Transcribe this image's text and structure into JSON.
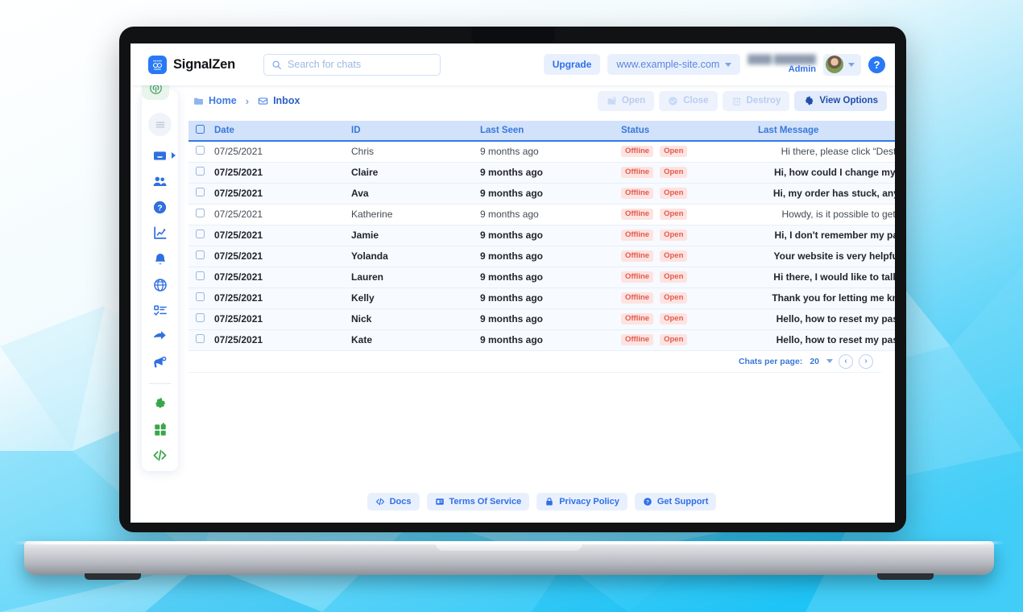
{
  "app": {
    "brand_name": "SignalZen",
    "brand_icon": "signalzen-logo-icon"
  },
  "header": {
    "search": {
      "placeholder": "Search for chats",
      "value": "",
      "icon": "search-icon"
    },
    "upgrade_label": "Upgrade",
    "site_selector": {
      "label": "www.example-site.com",
      "icon": "chevron-down-icon"
    },
    "user": {
      "name": "████ ███████",
      "role": "Admin",
      "avatar": "user-avatar"
    },
    "help_label": "?"
  },
  "breadcrumb": {
    "items": [
      {
        "label": "Home",
        "icon": "folder-icon"
      },
      {
        "label": "Inbox",
        "icon": "inbox-icon"
      }
    ],
    "separator": "›"
  },
  "toolbar": {
    "actions": [
      {
        "label": "Open",
        "icon": "open-external-icon",
        "enabled": false
      },
      {
        "label": "Close",
        "icon": "check-circle-icon",
        "enabled": false
      },
      {
        "label": "Destroy",
        "icon": "trash-icon",
        "enabled": false
      },
      {
        "label": "View Options",
        "icon": "gear-icon",
        "enabled": true
      }
    ]
  },
  "sidebar": {
    "logo_icon": "signal-broadcast-icon",
    "toggle_icon": "hamburger-menu-icon",
    "items": [
      {
        "name": "inbox",
        "icon": "inbox-icon",
        "color": "#2f6fe0",
        "has_submenu": true
      },
      {
        "name": "contacts",
        "icon": "users-icon",
        "color": "#2f6fe0",
        "has_submenu": false
      },
      {
        "name": "help",
        "icon": "question-circle-icon",
        "color": "#2f6fe0",
        "has_submenu": false
      },
      {
        "name": "analytics",
        "icon": "chart-icon",
        "color": "#2f6fe0",
        "has_submenu": false
      },
      {
        "name": "notifications",
        "icon": "bell-icon",
        "color": "#2f6fe0",
        "has_submenu": false
      },
      {
        "name": "web",
        "icon": "globe-icon",
        "color": "#2f6fe0",
        "has_submenu": false
      },
      {
        "name": "tasks",
        "icon": "checklist-icon",
        "color": "#2f6fe0",
        "has_submenu": false
      },
      {
        "name": "broadcast",
        "icon": "send-arrow-icon",
        "color": "#2f6fe0",
        "has_submenu": false
      },
      {
        "name": "campaigns",
        "icon": "megaphone-icon",
        "color": "#2f6fe0",
        "has_submenu": false
      }
    ],
    "bottom_items": [
      {
        "name": "settings",
        "icon": "gear-icon",
        "color": "#3aa64a"
      },
      {
        "name": "apps",
        "icon": "grid-apps-icon",
        "color": "#3aa64a"
      },
      {
        "name": "developers",
        "icon": "code-icon",
        "color": "#3aa64a"
      }
    ]
  },
  "table": {
    "columns": [
      "Date",
      "ID",
      "Last Seen",
      "Status",
      "Last Message"
    ],
    "rows": [
      {
        "read": true,
        "date": "07/25/2021",
        "id": "Chris",
        "last_seen": "9 months ago",
        "status": [
          "Offline",
          "Open"
        ],
        "message": "Hi there, please click “Desti..."
      },
      {
        "read": false,
        "date": "07/25/2021",
        "id": "Claire",
        "last_seen": "9 months ago",
        "status": [
          "Offline",
          "Open"
        ],
        "message": "Hi, how could I change my ..."
      },
      {
        "read": false,
        "date": "07/25/2021",
        "id": "Ava",
        "last_seen": "9 months ago",
        "status": [
          "Offline",
          "Open"
        ],
        "message": "Hi, my order has stuck, any..."
      },
      {
        "read": true,
        "date": "07/25/2021",
        "id": "Katherine",
        "last_seen": "9 months ago",
        "status": [
          "Offline",
          "Open"
        ],
        "message": "Howdy, is it possible to get ..."
      },
      {
        "read": false,
        "date": "07/25/2021",
        "id": "Jamie",
        "last_seen": "9 months ago",
        "status": [
          "Offline",
          "Open"
        ],
        "message": "Hi, I don't remember my pa..."
      },
      {
        "read": false,
        "date": "07/25/2021",
        "id": "Yolanda",
        "last_seen": "9 months ago",
        "status": [
          "Offline",
          "Open"
        ],
        "message": "Your website is very helpfu..."
      },
      {
        "read": false,
        "date": "07/25/2021",
        "id": "Lauren",
        "last_seen": "9 months ago",
        "status": [
          "Offline",
          "Open"
        ],
        "message": "Hi there, I would like to talk..."
      },
      {
        "read": false,
        "date": "07/25/2021",
        "id": "Kelly",
        "last_seen": "9 months ago",
        "status": [
          "Offline",
          "Open"
        ],
        "message": "Thank you for letting me kn..."
      },
      {
        "read": false,
        "date": "07/25/2021",
        "id": "Nick",
        "last_seen": "9 months ago",
        "status": [
          "Offline",
          "Open"
        ],
        "message": "Hello, how to reset my pas..."
      },
      {
        "read": false,
        "date": "07/25/2021",
        "id": "Kate",
        "last_seen": "9 months ago",
        "status": [
          "Offline",
          "Open"
        ],
        "message": "Hello, how to reset my pas..."
      }
    ]
  },
  "pagination": {
    "label": "Chats per page:",
    "value": "20",
    "prev_icon": "chevron-left-icon",
    "next_icon": "chevron-right-icon"
  },
  "footer": {
    "links": [
      {
        "label": "Docs",
        "icon": "code-icon"
      },
      {
        "label": "Terms Of Service",
        "icon": "document-icon"
      },
      {
        "label": "Privacy Policy",
        "icon": "lock-icon"
      },
      {
        "label": "Get Support",
        "icon": "question-circle-icon"
      }
    ]
  },
  "colors": {
    "accent_blue": "#2979f6",
    "header_row": "#d2e2fb",
    "badge_red_bg": "#fde3e1",
    "badge_red_text": "#e05c4e",
    "green": "#3aa64a",
    "background_cyan": "#2ec8f5"
  }
}
